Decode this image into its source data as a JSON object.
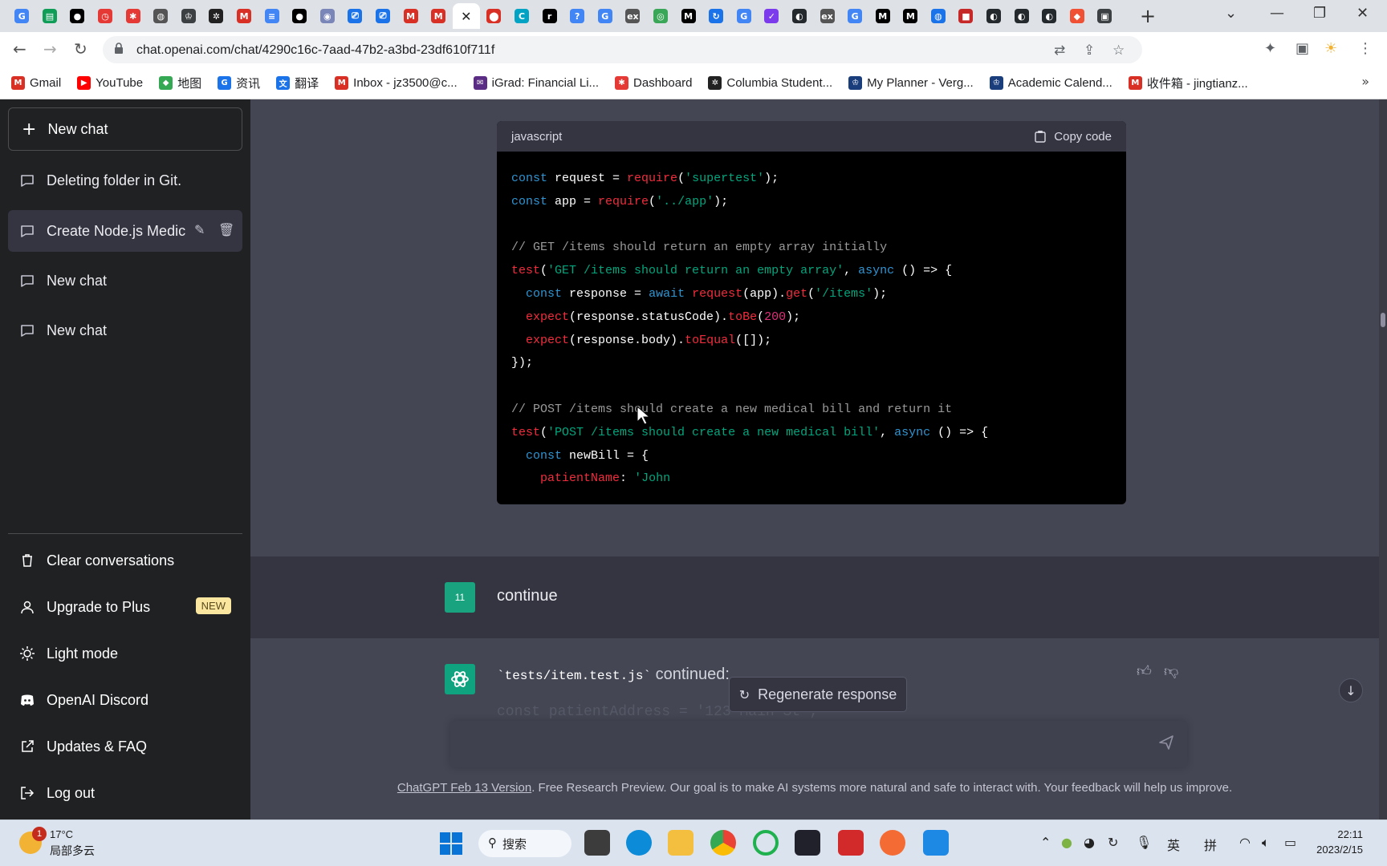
{
  "browser": {
    "tabs": [
      {
        "icon": "google-icon",
        "glyph": "G",
        "color": "#4285f4"
      },
      {
        "icon": "sheets-icon",
        "glyph": "▤",
        "color": "#0f9d58"
      },
      {
        "icon": "medium-icon",
        "glyph": "●",
        "color": "#000000"
      },
      {
        "icon": "clock-icon",
        "glyph": "◷",
        "color": "#e53935"
      },
      {
        "icon": "asterisk-icon",
        "glyph": "✱",
        "color": "#e53935"
      },
      {
        "icon": "globe-icon",
        "glyph": "◍",
        "color": "#555555"
      },
      {
        "icon": "crown-icon",
        "glyph": "♔",
        "color": "#3c4043"
      },
      {
        "icon": "pinwheel-icon",
        "glyph": "✲",
        "color": "#222222"
      },
      {
        "icon": "gmail-icon",
        "glyph": "M",
        "color": "#d93025"
      },
      {
        "icon": "docs-icon",
        "glyph": "≡",
        "color": "#4285f4"
      },
      {
        "icon": "medium-icon",
        "glyph": "●",
        "color": "#000000"
      },
      {
        "icon": "planet-icon",
        "glyph": "◉",
        "color": "#7a86b8"
      },
      {
        "icon": "tv-icon",
        "glyph": "⎚",
        "color": "#1a73e8"
      },
      {
        "icon": "tv-icon",
        "glyph": "⎚",
        "color": "#1a73e8"
      },
      {
        "icon": "gmail-icon",
        "glyph": "M",
        "color": "#d93025"
      },
      {
        "icon": "gmail-icon",
        "glyph": "M",
        "color": "#d93025"
      },
      {
        "icon": "close-icon",
        "glyph": "✕",
        "color": "#ffffff",
        "active": true
      },
      {
        "icon": "maps-pin-icon",
        "glyph": "⬤",
        "color": "#d93025"
      },
      {
        "icon": "c-icon",
        "glyph": "C",
        "color": "#00a3c4"
      },
      {
        "icon": "r-icon",
        "glyph": "r",
        "color": "#000000"
      },
      {
        "icon": "help-icon",
        "glyph": "?",
        "color": "#4285f4"
      },
      {
        "icon": "google-icon",
        "glyph": "G",
        "color": "#4285f4"
      },
      {
        "icon": "ex-icon",
        "glyph": "ex",
        "color": "#555555"
      },
      {
        "icon": "eye-icon",
        "glyph": "◎",
        "color": "#3aa657"
      },
      {
        "icon": "m-icon",
        "glyph": "M",
        "color": "#000000"
      },
      {
        "icon": "refresh-icon",
        "glyph": "↻",
        "color": "#1a73e8"
      },
      {
        "icon": "google-icon",
        "glyph": "G",
        "color": "#4285f4"
      },
      {
        "icon": "check-icon",
        "glyph": "✓",
        "color": "#7c3aed"
      },
      {
        "icon": "github-icon",
        "glyph": "◐",
        "color": "#24292e"
      },
      {
        "icon": "ex-icon",
        "glyph": "ex",
        "color": "#555555"
      },
      {
        "icon": "google-icon",
        "glyph": "G",
        "color": "#4285f4"
      },
      {
        "icon": "m-icon",
        "glyph": "M",
        "color": "#000000"
      },
      {
        "icon": "m-icon",
        "glyph": "M",
        "color": "#000000"
      },
      {
        "icon": "globe-icon",
        "glyph": "◍",
        "color": "#1a73e8"
      },
      {
        "icon": "square-icon",
        "glyph": "■",
        "color": "#c62828"
      },
      {
        "icon": "github-icon",
        "glyph": "◐",
        "color": "#24292e"
      },
      {
        "icon": "github-icon",
        "glyph": "◐",
        "color": "#24292e"
      },
      {
        "icon": "github-icon",
        "glyph": "◐",
        "color": "#24292e"
      },
      {
        "icon": "git-icon",
        "glyph": "◆",
        "color": "#f05033"
      },
      {
        "icon": "terminal-icon",
        "glyph": "▣",
        "color": "#3c4043"
      }
    ],
    "url": "chat.openai.com/chat/4290c16c-7aad-47b2-a3bd-23df610f711f",
    "bookmarks": [
      {
        "label": "Gmail",
        "icon": "gmail-icon",
        "glyph": "M",
        "color": "#d93025"
      },
      {
        "label": "YouTube",
        "icon": "youtube-icon",
        "glyph": "▶",
        "color": "#ff0000"
      },
      {
        "label": "地图",
        "icon": "maps-icon",
        "glyph": "◆",
        "color": "#34a853"
      },
      {
        "label": "资讯",
        "icon": "news-icon",
        "glyph": "G",
        "color": "#1a73e8"
      },
      {
        "label": "翻译",
        "icon": "translate-icon",
        "glyph": "文",
        "color": "#1a73e8"
      },
      {
        "label": "Inbox - jz3500@c...",
        "icon": "gmail-icon",
        "glyph": "M",
        "color": "#d93025"
      },
      {
        "label": "iGrad: Financial Li...",
        "icon": "mail-icon",
        "glyph": "✉",
        "color": "#5b2c83"
      },
      {
        "label": "Dashboard",
        "icon": "dashboard-icon",
        "glyph": "✱",
        "color": "#e53935"
      },
      {
        "label": "Columbia Student...",
        "icon": "pinwheel-icon",
        "glyph": "✲",
        "color": "#222222"
      },
      {
        "label": "My Planner - Verg...",
        "icon": "crown-icon",
        "glyph": "♔",
        "color": "#1a3d7c"
      },
      {
        "label": "Academic Calend...",
        "icon": "crown-icon",
        "glyph": "♔",
        "color": "#1a3d7c"
      },
      {
        "label": "收件箱 - jingtianz...",
        "icon": "gmail-icon",
        "glyph": "M",
        "color": "#d93025"
      }
    ]
  },
  "sidebar": {
    "new_chat": "New chat",
    "conversations": [
      {
        "label": "Deleting folder in Git."
      },
      {
        "label": "Create Node.js Medic",
        "active": true
      },
      {
        "label": "New chat"
      },
      {
        "label": "New chat"
      }
    ],
    "menu": [
      {
        "label": "Clear conversations",
        "icon": "trash-icon"
      },
      {
        "label": "Upgrade to Plus",
        "icon": "user-icon",
        "badge": "NEW"
      },
      {
        "label": "Light mode",
        "icon": "sun-icon"
      },
      {
        "label": "OpenAI Discord",
        "icon": "discord-icon"
      },
      {
        "label": "Updates & FAQ",
        "icon": "external-link-icon"
      },
      {
        "label": "Log out",
        "icon": "logout-icon"
      }
    ]
  },
  "code": {
    "language": "javascript",
    "copy_label": "Copy code",
    "lines": [
      [
        [
          "kw",
          "const"
        ],
        [
          "t",
          " request = "
        ],
        [
          "fn",
          "require"
        ],
        [
          "t",
          "("
        ],
        [
          "str",
          "'supertest'"
        ],
        [
          "t",
          ");"
        ]
      ],
      [
        [
          "kw",
          "const"
        ],
        [
          "t",
          " app = "
        ],
        [
          "fn",
          "require"
        ],
        [
          "t",
          "("
        ],
        [
          "str",
          "'../app'"
        ],
        [
          "t",
          ");"
        ]
      ],
      [],
      [
        [
          "cm",
          "// GET /items should return an empty array initially"
        ]
      ],
      [
        [
          "fn",
          "test"
        ],
        [
          "t",
          "("
        ],
        [
          "str",
          "'GET /items should return an empty array'"
        ],
        [
          "t",
          ", "
        ],
        [
          "kw",
          "async"
        ],
        [
          "t",
          " () => {"
        ]
      ],
      [
        [
          "t",
          "  "
        ],
        [
          "kw",
          "const"
        ],
        [
          "t",
          " response = "
        ],
        [
          "kw",
          "await"
        ],
        [
          "t",
          " "
        ],
        [
          "fn",
          "request"
        ],
        [
          "t",
          "(app)."
        ],
        [
          "fn",
          "get"
        ],
        [
          "t",
          "("
        ],
        [
          "str",
          "'/items'"
        ],
        [
          "t",
          ");"
        ]
      ],
      [
        [
          "t",
          "  "
        ],
        [
          "fn",
          "expect"
        ],
        [
          "t",
          "(response.statusCode)."
        ],
        [
          "fn",
          "toBe"
        ],
        [
          "t",
          "("
        ],
        [
          "num",
          "200"
        ],
        [
          "t",
          ");"
        ]
      ],
      [
        [
          "t",
          "  "
        ],
        [
          "fn",
          "expect"
        ],
        [
          "t",
          "(response.body)."
        ],
        [
          "fn",
          "toEqual"
        ],
        [
          "t",
          "([]);"
        ]
      ],
      [
        [
          "t",
          "});"
        ]
      ],
      [],
      [
        [
          "cm",
          "// POST /items should create a new medical bill and return it"
        ]
      ],
      [
        [
          "fn",
          "test"
        ],
        [
          "t",
          "("
        ],
        [
          "str",
          "'POST /items should create a new medical bill'"
        ],
        [
          "t",
          ", "
        ],
        [
          "kw",
          "async"
        ],
        [
          "t",
          " () => {"
        ]
      ],
      [
        [
          "t",
          "  "
        ],
        [
          "kw",
          "const"
        ],
        [
          "t",
          " newBill = {"
        ]
      ],
      [
        [
          "t",
          "    "
        ],
        [
          "prop",
          "patientName"
        ],
        [
          "t",
          ": "
        ],
        [
          "str",
          "'John"
        ]
      ]
    ]
  },
  "chat": {
    "user_avatar": "11",
    "user_message": "continue",
    "assistant_code_ref": "`tests/item.test.js`",
    "assistant_text": " continued:",
    "faded_line": "const patientAddress = '123 Main St';",
    "regenerate": "Regenerate response",
    "footer_link": "ChatGPT Feb 13 Version",
    "footer_text": ". Free Research Preview. Our goal is to make AI systems more natural and safe to interact with. Your feedback will help us improve."
  },
  "taskbar": {
    "weather_badge": "1",
    "temperature": "17°C",
    "weather_desc": "局部多云",
    "search_label": "搜索",
    "ime1": "英",
    "ime2": "拼",
    "time": "22:11",
    "date": "2023/2/15"
  }
}
